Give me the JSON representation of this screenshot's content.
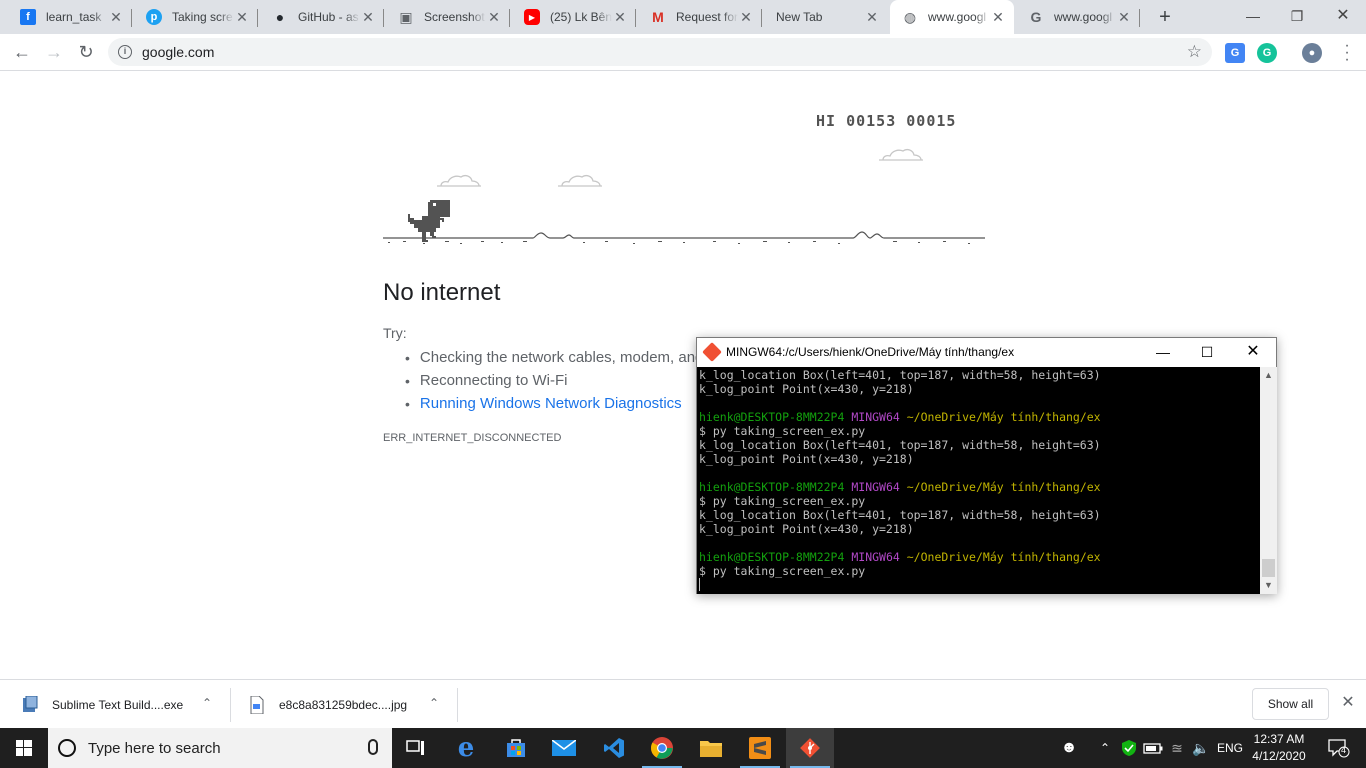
{
  "browser": {
    "tabs": [
      {
        "title": "learn_task",
        "icon": "facebook-icon",
        "color": "#1877f2"
      },
      {
        "title": "Taking scre",
        "icon": "pythonanywhere-icon",
        "color": "#1da1f2"
      },
      {
        "title": "GitHub - as",
        "icon": "github-icon",
        "color": "#24292e"
      },
      {
        "title": "Screenshot",
        "icon": "document-icon",
        "color": "#5f6368"
      },
      {
        "title": "(25) Lk Bên",
        "icon": "youtube-icon",
        "color": "#ff0000"
      },
      {
        "title": "Request for",
        "icon": "gmail-icon",
        "color": "#d93025"
      },
      {
        "title": "New Tab",
        "icon": "",
        "color": ""
      },
      {
        "title": "www.googl",
        "icon": "globe-icon",
        "color": "#5f6368"
      },
      {
        "title": "www.googl",
        "icon": "google-icon",
        "color": "#5f6368"
      }
    ],
    "url": "google.com"
  },
  "game": {
    "hi_label": "HI",
    "hi_score": "00153",
    "score": "00015"
  },
  "error_page": {
    "title": "No internet",
    "try_label": "Try:",
    "suggestions": [
      "Checking the network cables, modem, and router",
      "Reconnecting to Wi-Fi",
      "Running Windows Network Diagnostics"
    ],
    "error_code": "ERR_INTERNET_DISCONNECTED"
  },
  "terminal": {
    "title": "MINGW64:/c/Users/hienk/OneDrive/Máy tính/thang/ex",
    "lines": [
      {
        "type": "out",
        "text": "k_log_location Box(left=401, top=187, width=58, height=63)"
      },
      {
        "type": "out",
        "text": "k_log_point Point(x=430, y=218)"
      },
      {
        "type": "blank"
      },
      {
        "type": "prompt",
        "user": "hienk@DESKTOP-8MM22P4",
        "sys": "MINGW64",
        "path": "~/OneDrive/Máy tính/thang/ex"
      },
      {
        "type": "out",
        "text": "$ py taking_screen_ex.py"
      },
      {
        "type": "out",
        "text": "k_log_location Box(left=401, top=187, width=58, height=63)"
      },
      {
        "type": "out",
        "text": "k_log_point Point(x=430, y=218)"
      },
      {
        "type": "blank"
      },
      {
        "type": "prompt",
        "user": "hienk@DESKTOP-8MM22P4",
        "sys": "MINGW64",
        "path": "~/OneDrive/Máy tính/thang/ex"
      },
      {
        "type": "out",
        "text": "$ py taking_screen_ex.py"
      },
      {
        "type": "out",
        "text": "k_log_location Box(left=401, top=187, width=58, height=63)"
      },
      {
        "type": "out",
        "text": "k_log_point Point(x=430, y=218)"
      },
      {
        "type": "blank"
      },
      {
        "type": "prompt",
        "user": "hienk@DESKTOP-8MM22P4",
        "sys": "MINGW64",
        "path": "~/OneDrive/Máy tính/thang/ex"
      },
      {
        "type": "out",
        "text": "$ py taking_screen_ex.py"
      },
      {
        "type": "cursor"
      }
    ]
  },
  "downloads": {
    "items": [
      {
        "name": "Sublime Text Build....exe"
      },
      {
        "name": "e8c8a831259bdec....jpg"
      }
    ],
    "show_all": "Show all"
  },
  "taskbar": {
    "search_placeholder": "Type here to search",
    "language": "ENG",
    "time": "12:37 AM",
    "date": "4/12/2020",
    "notification_count": "4"
  }
}
